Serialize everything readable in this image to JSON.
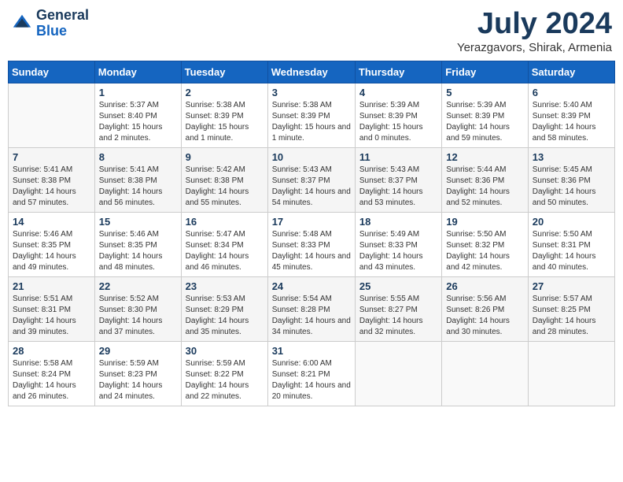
{
  "header": {
    "logo_line1": "General",
    "logo_line2": "Blue",
    "month": "July 2024",
    "location": "Yerazgavors, Shirak, Armenia"
  },
  "weekdays": [
    "Sunday",
    "Monday",
    "Tuesday",
    "Wednesday",
    "Thursday",
    "Friday",
    "Saturday"
  ],
  "weeks": [
    [
      {
        "day": "",
        "info": ""
      },
      {
        "day": "1",
        "info": "Sunrise: 5:37 AM\nSunset: 8:40 PM\nDaylight: 15 hours\nand 2 minutes."
      },
      {
        "day": "2",
        "info": "Sunrise: 5:38 AM\nSunset: 8:39 PM\nDaylight: 15 hours\nand 1 minute."
      },
      {
        "day": "3",
        "info": "Sunrise: 5:38 AM\nSunset: 8:39 PM\nDaylight: 15 hours\nand 1 minute."
      },
      {
        "day": "4",
        "info": "Sunrise: 5:39 AM\nSunset: 8:39 PM\nDaylight: 15 hours\nand 0 minutes."
      },
      {
        "day": "5",
        "info": "Sunrise: 5:39 AM\nSunset: 8:39 PM\nDaylight: 14 hours\nand 59 minutes."
      },
      {
        "day": "6",
        "info": "Sunrise: 5:40 AM\nSunset: 8:39 PM\nDaylight: 14 hours\nand 58 minutes."
      }
    ],
    [
      {
        "day": "7",
        "info": "Sunrise: 5:41 AM\nSunset: 8:38 PM\nDaylight: 14 hours\nand 57 minutes."
      },
      {
        "day": "8",
        "info": "Sunrise: 5:41 AM\nSunset: 8:38 PM\nDaylight: 14 hours\nand 56 minutes."
      },
      {
        "day": "9",
        "info": "Sunrise: 5:42 AM\nSunset: 8:38 PM\nDaylight: 14 hours\nand 55 minutes."
      },
      {
        "day": "10",
        "info": "Sunrise: 5:43 AM\nSunset: 8:37 PM\nDaylight: 14 hours\nand 54 minutes."
      },
      {
        "day": "11",
        "info": "Sunrise: 5:43 AM\nSunset: 8:37 PM\nDaylight: 14 hours\nand 53 minutes."
      },
      {
        "day": "12",
        "info": "Sunrise: 5:44 AM\nSunset: 8:36 PM\nDaylight: 14 hours\nand 52 minutes."
      },
      {
        "day": "13",
        "info": "Sunrise: 5:45 AM\nSunset: 8:36 PM\nDaylight: 14 hours\nand 50 minutes."
      }
    ],
    [
      {
        "day": "14",
        "info": "Sunrise: 5:46 AM\nSunset: 8:35 PM\nDaylight: 14 hours\nand 49 minutes."
      },
      {
        "day": "15",
        "info": "Sunrise: 5:46 AM\nSunset: 8:35 PM\nDaylight: 14 hours\nand 48 minutes."
      },
      {
        "day": "16",
        "info": "Sunrise: 5:47 AM\nSunset: 8:34 PM\nDaylight: 14 hours\nand 46 minutes."
      },
      {
        "day": "17",
        "info": "Sunrise: 5:48 AM\nSunset: 8:33 PM\nDaylight: 14 hours\nand 45 minutes."
      },
      {
        "day": "18",
        "info": "Sunrise: 5:49 AM\nSunset: 8:33 PM\nDaylight: 14 hours\nand 43 minutes."
      },
      {
        "day": "19",
        "info": "Sunrise: 5:50 AM\nSunset: 8:32 PM\nDaylight: 14 hours\nand 42 minutes."
      },
      {
        "day": "20",
        "info": "Sunrise: 5:50 AM\nSunset: 8:31 PM\nDaylight: 14 hours\nand 40 minutes."
      }
    ],
    [
      {
        "day": "21",
        "info": "Sunrise: 5:51 AM\nSunset: 8:31 PM\nDaylight: 14 hours\nand 39 minutes."
      },
      {
        "day": "22",
        "info": "Sunrise: 5:52 AM\nSunset: 8:30 PM\nDaylight: 14 hours\nand 37 minutes."
      },
      {
        "day": "23",
        "info": "Sunrise: 5:53 AM\nSunset: 8:29 PM\nDaylight: 14 hours\nand 35 minutes."
      },
      {
        "day": "24",
        "info": "Sunrise: 5:54 AM\nSunset: 8:28 PM\nDaylight: 14 hours\nand 34 minutes."
      },
      {
        "day": "25",
        "info": "Sunrise: 5:55 AM\nSunset: 8:27 PM\nDaylight: 14 hours\nand 32 minutes."
      },
      {
        "day": "26",
        "info": "Sunrise: 5:56 AM\nSunset: 8:26 PM\nDaylight: 14 hours\nand 30 minutes."
      },
      {
        "day": "27",
        "info": "Sunrise: 5:57 AM\nSunset: 8:25 PM\nDaylight: 14 hours\nand 28 minutes."
      }
    ],
    [
      {
        "day": "28",
        "info": "Sunrise: 5:58 AM\nSunset: 8:24 PM\nDaylight: 14 hours\nand 26 minutes."
      },
      {
        "day": "29",
        "info": "Sunrise: 5:59 AM\nSunset: 8:23 PM\nDaylight: 14 hours\nand 24 minutes."
      },
      {
        "day": "30",
        "info": "Sunrise: 5:59 AM\nSunset: 8:22 PM\nDaylight: 14 hours\nand 22 minutes."
      },
      {
        "day": "31",
        "info": "Sunrise: 6:00 AM\nSunset: 8:21 PM\nDaylight: 14 hours\nand 20 minutes."
      },
      {
        "day": "",
        "info": ""
      },
      {
        "day": "",
        "info": ""
      },
      {
        "day": "",
        "info": ""
      }
    ]
  ]
}
